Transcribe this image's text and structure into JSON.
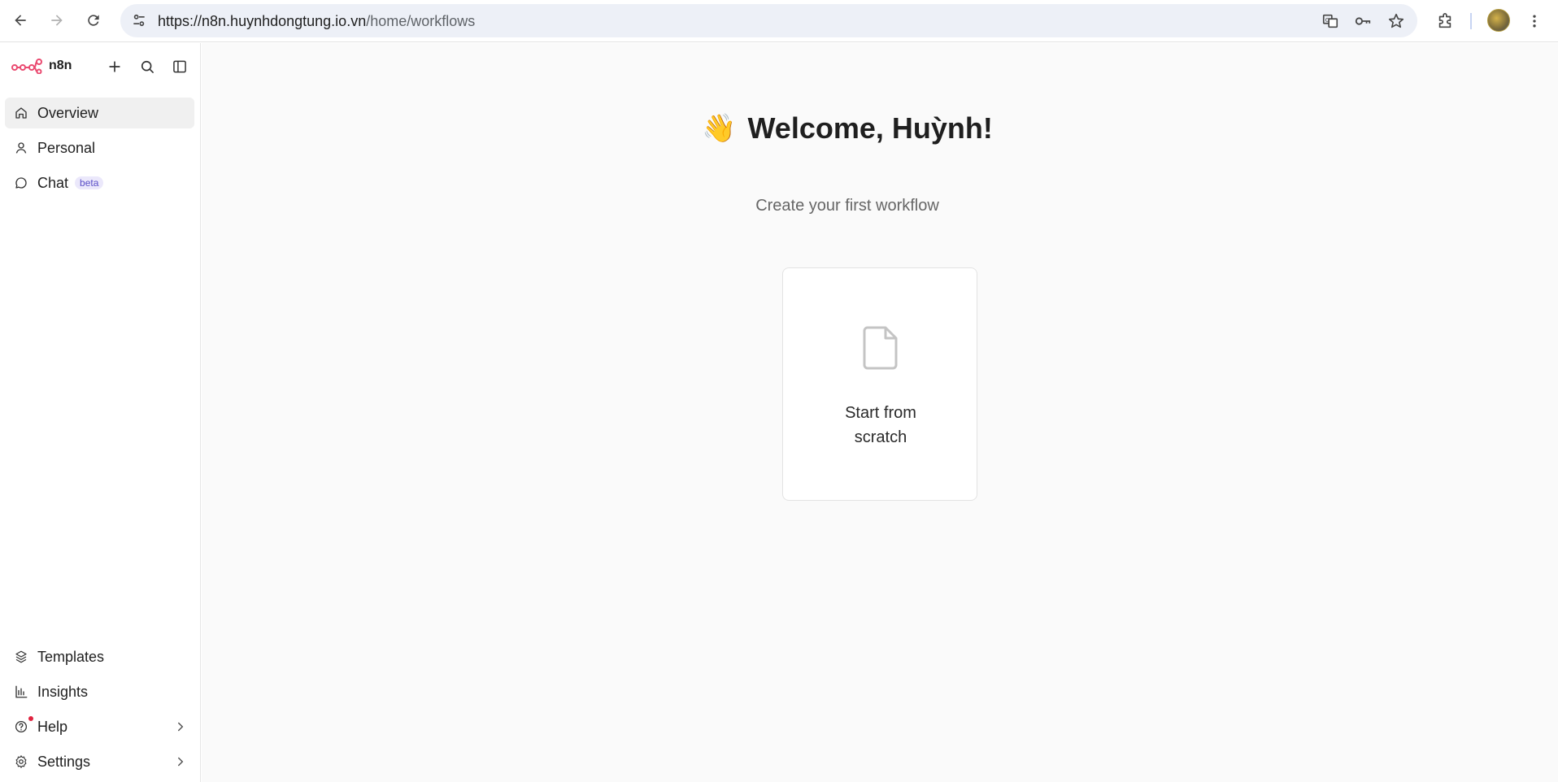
{
  "browser": {
    "url_host": "https://n8n.huynhdongtung.io.vn",
    "url_path": "/home/workflows"
  },
  "sidebar": {
    "brand": "n8n",
    "top_items": [
      {
        "label": "Overview",
        "icon": "home-icon",
        "active": true
      },
      {
        "label": "Personal",
        "icon": "user-icon",
        "active": false
      },
      {
        "label": "Chat",
        "icon": "chat-icon",
        "badge": "beta",
        "active": false
      }
    ],
    "bottom_items": [
      {
        "label": "Templates",
        "icon": "templates-icon"
      },
      {
        "label": "Insights",
        "icon": "insights-icon"
      },
      {
        "label": "Help",
        "icon": "help-icon",
        "has_notification": true
      },
      {
        "label": "Settings",
        "icon": "gear-icon"
      }
    ]
  },
  "main": {
    "welcome": "Welcome, Huỳnh!",
    "wave_emoji": "👋",
    "subtitle": "Create your first workflow",
    "card_label": "Start from scratch"
  },
  "colors": {
    "brand": "#ea4b71",
    "beta_text": "#5b4fc7",
    "beta_bg": "#ebe8fb",
    "notification": "#e0233f"
  }
}
